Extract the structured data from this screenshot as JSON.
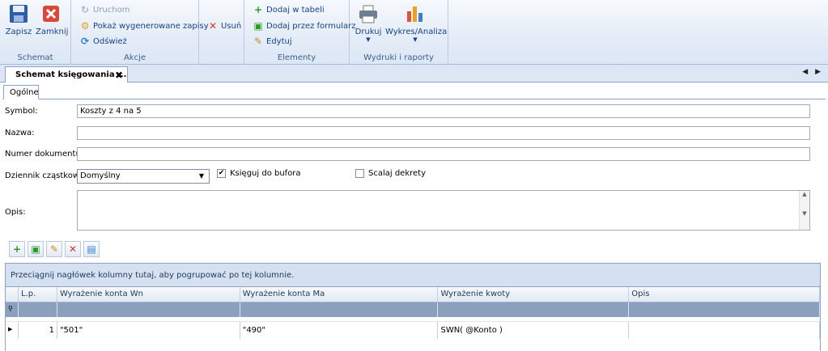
{
  "ribbon": {
    "schemat": {
      "label": "Schemat",
      "save": "Zapisz",
      "close": "Zamknij"
    },
    "akcje": {
      "label": "Akcje",
      "run": "Uruchom",
      "show_generated": "Pokaż wygenerowane zapisy",
      "refresh": "Odśwież"
    },
    "delete": "Usuń",
    "elementy": {
      "label": "Elementy",
      "add_table": "Dodaj w tabeli",
      "add_form": "Dodaj przez formularz",
      "edit": "Edytuj"
    },
    "wydruki": {
      "label": "Wydruki i raporty",
      "print": "Drukuj",
      "chart": "Wykres/Analiza"
    }
  },
  "document_tab": {
    "title": "Schemat księgowania ...",
    "close": "✖"
  },
  "nav_arrows": "◀ ▶",
  "inner_tab": "Ogólne",
  "form": {
    "symbol_label": "Symbol:",
    "symbol_value": "Koszty z 4 na 5",
    "nazwa_label": "Nazwa:",
    "nazwa_value": "",
    "numer_label": "Numer dokumentu:",
    "numer_value": "",
    "dziennik_label": "Dziennik cząstkowy:",
    "dziennik_value": "Domyślny",
    "ksieguj_label": "Księguj do bufora",
    "ksieguj_checked": true,
    "scalaj_label": "Scalaj dekrety",
    "scalaj_checked": false,
    "opis_label": "Opis:",
    "opis_value": ""
  },
  "grid": {
    "group_hint": "Przeciągnij nagłówek kolumny tutaj, aby pogrupować po tej kolumnie.",
    "columns": [
      "L.p.",
      "Wyrażenie konta Wn",
      "Wyrażenie konta Ma",
      "Wyrażenie kwoty",
      "Opis"
    ],
    "rows": [
      {
        "lp": "1",
        "wn": "\"501\"",
        "ma": "\"490\"",
        "kwota": "SWN( @Konto )",
        "opis": ""
      }
    ]
  },
  "colors": {
    "ribbon_bg": "#dce7f5",
    "accent": "#15428b",
    "filter_row": "#8ba0bd"
  }
}
